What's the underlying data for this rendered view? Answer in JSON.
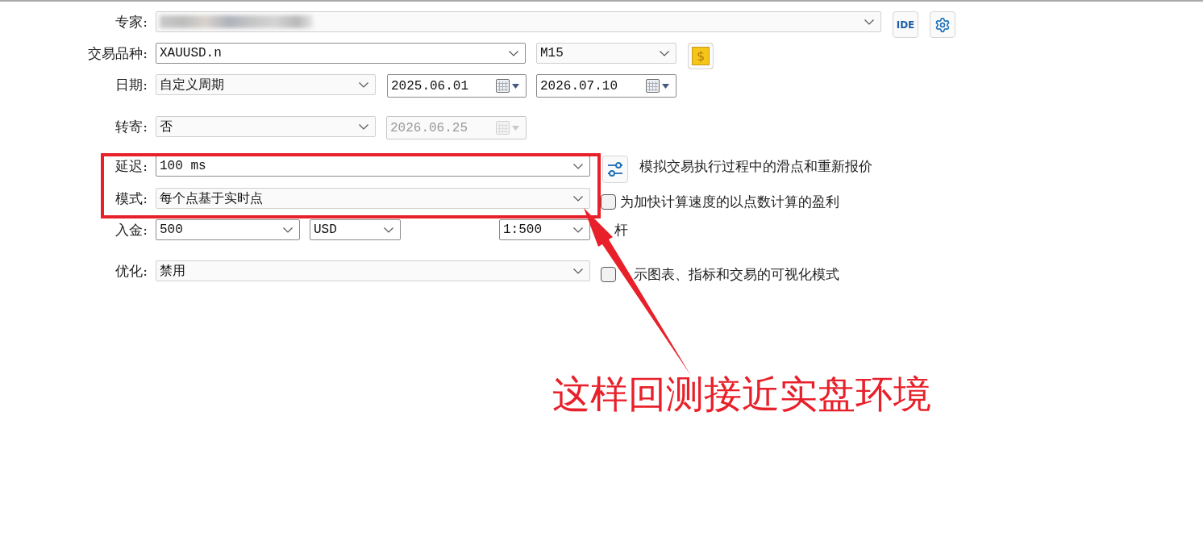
{
  "form": {
    "rows": [
      {
        "label": "专家:",
        "controls": [
          {
            "kind": "select",
            "blurred": true
          },
          {
            "kind": "text-button",
            "label": "IDE"
          },
          {
            "kind": "gear-button"
          }
        ]
      },
      {
        "label": "交易品种:",
        "controls": [
          {
            "kind": "combo",
            "value": "XAUUSD.n"
          },
          {
            "kind": "select",
            "value": "M15"
          },
          {
            "kind": "coin-button",
            "label": "$"
          }
        ]
      },
      {
        "label": "日期:",
        "controls": [
          {
            "kind": "select",
            "value": "自定义周期"
          },
          {
            "kind": "date",
            "value": "2025.06.01",
            "disabled": false
          },
          {
            "kind": "date",
            "value": "2026.07.10",
            "disabled": false
          }
        ]
      },
      {
        "label": "转寄:",
        "controls": [
          {
            "kind": "select",
            "value": "否"
          },
          {
            "kind": "date",
            "value": "2026.06.25",
            "disabled": true
          }
        ]
      },
      {
        "label": "延迟:",
        "controls": [
          {
            "kind": "combo",
            "value": "100 ms"
          },
          {
            "kind": "sliders-button"
          },
          {
            "kind": "note",
            "text": "模拟交易执行过程中的滑点和重新报价"
          }
        ]
      },
      {
        "label": "模式:",
        "controls": [
          {
            "kind": "select",
            "value": "每个点基于实时点"
          },
          {
            "kind": "checkbox",
            "label": "为加快计算速度的以点数计算的盈利",
            "checked": false
          }
        ]
      },
      {
        "label": "入金:",
        "controls": [
          {
            "kind": "combo",
            "value": "500"
          },
          {
            "kind": "combo",
            "value": "USD"
          },
          {
            "kind": "combo",
            "value": "1:500"
          },
          {
            "kind": "note",
            "text": "杆"
          }
        ]
      },
      {
        "label": "优化:",
        "controls": [
          {
            "kind": "select",
            "value": "禁用"
          },
          {
            "kind": "checkbox",
            "label": "示图表、指标和交易的可视化模式",
            "checked": false
          }
        ]
      }
    ]
  },
  "annotation": {
    "text": "这样回测接近实盘环境"
  }
}
